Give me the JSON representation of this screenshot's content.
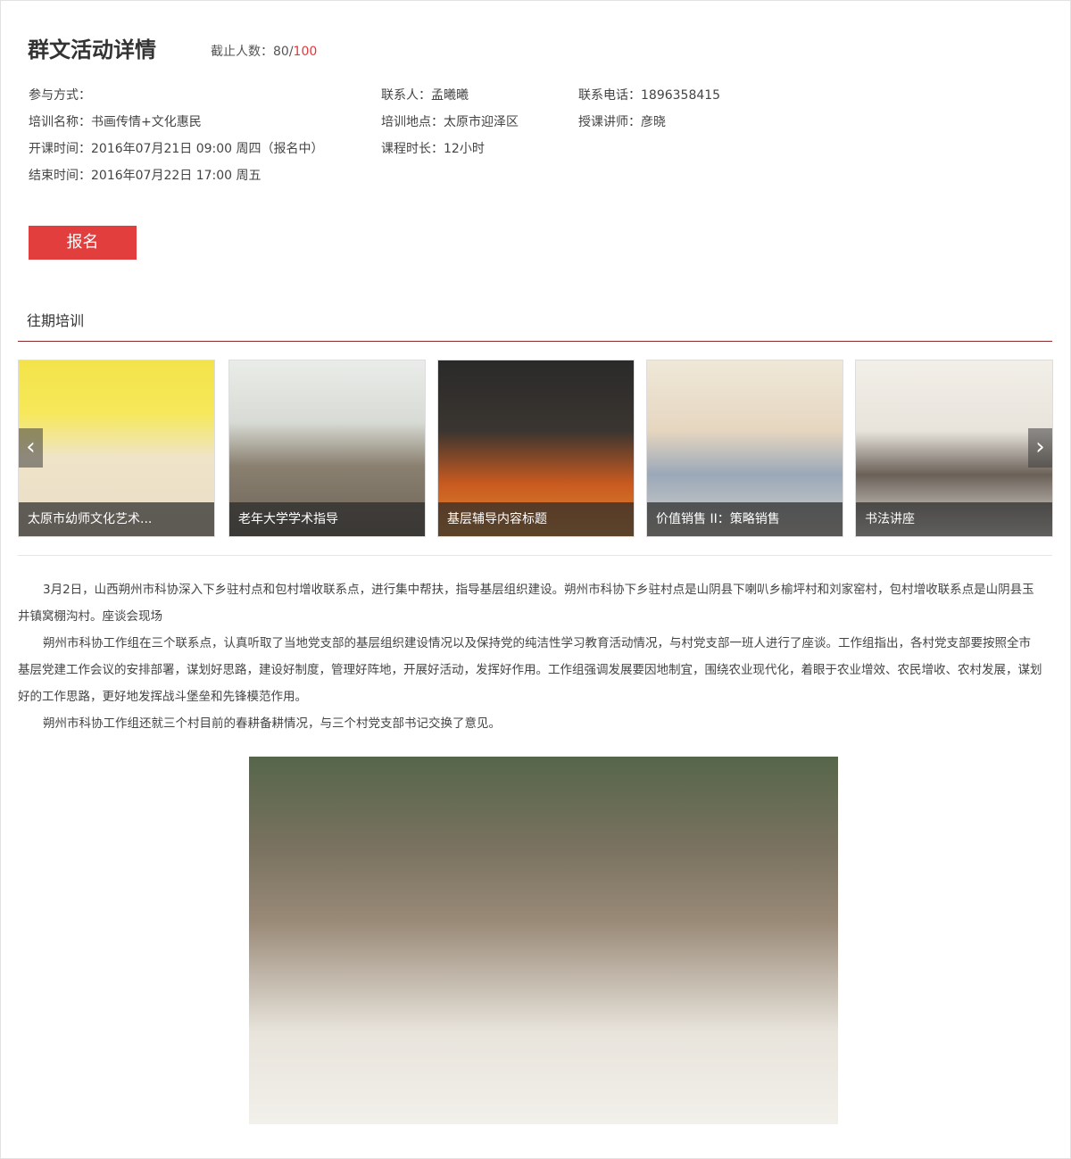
{
  "header": {
    "title": "群文活动详情",
    "quota_label": "截止人数：",
    "quota_current": "80/",
    "quota_max": "100"
  },
  "details": {
    "participation": "参与方式：",
    "contact": "联系人：孟曦曦",
    "phone": "联系电话：1896358415",
    "training_name": "培训名称：书画传情+文化惠民",
    "location": "培训地点：太原市迎泽区",
    "lecturer": "授课讲师：彦晓",
    "start_time": "开课时间：2016年07月21日 09:00 周四（报名中）",
    "duration": "课程时长：12小时",
    "end_time": "结束时间：2016年07月22日 17:00 周五"
  },
  "signup_button": "报名",
  "past_section": {
    "title": "往期培训",
    "items": [
      {
        "caption": "太原市幼师文化艺术..."
      },
      {
        "caption": "老年大学学术指导"
      },
      {
        "caption": "基层辅导内容标题"
      },
      {
        "caption": "价值销售 II：策略销售"
      },
      {
        "caption": "书法讲座"
      }
    ],
    "prev_icon": "chevron-left-icon",
    "next_icon": "chevron-right-icon"
  },
  "article": {
    "paragraphs": [
      "3月2日，山西朔州市科协深入下乡驻村点和包村增收联系点，进行集中帮扶，指导基层组织建设。朔州市科协下乡驻村点是山阴县下喇叭乡榆坪村和刘家窑村，包村增收联系点是山阴县玉井镇窝棚沟村。座谈会现场",
      "朔州市科协工作组在三个联系点，认真听取了当地党支部的基层组织建设情况以及保持党的纯洁性学习教育活动情况，与村党支部一班人进行了座谈。工作组指出，各村党支部要按照全市基层党建工作会议的安排部署，谋划好思路，建设好制度，管理好阵地，开展好活动，发挥好作用。工作组强调发展要因地制宜，围绕农业现代化，着眼于农业增效、农民增收、农村发展，谋划好的工作思路，更好地发挥战斗堡垒和先锋模范作用。",
      "朔州市科协工作组还就三个村目前的春耕备耕情况，与三个村党支部书记交换了意见。"
    ]
  }
}
